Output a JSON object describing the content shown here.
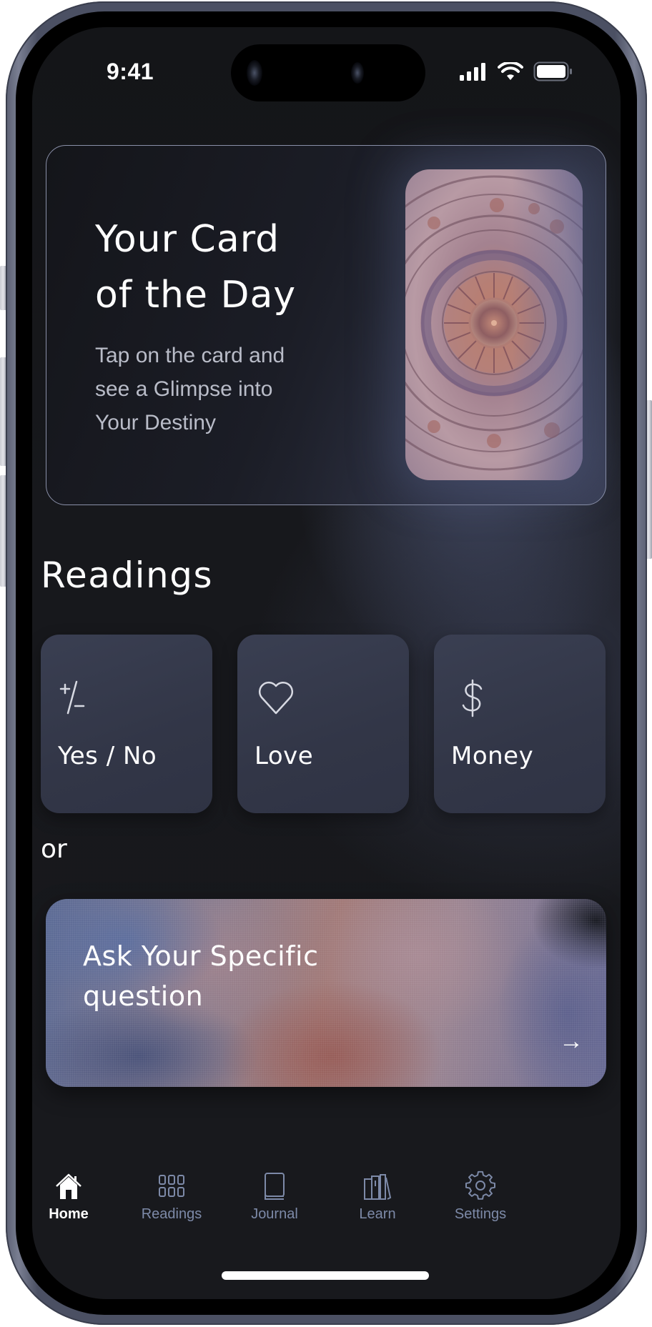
{
  "status_bar": {
    "time": "9:41",
    "icons": [
      "cellular-signal-icon",
      "wifi-icon",
      "battery-icon"
    ]
  },
  "card_of_day": {
    "title_line1": "Your Card",
    "title_line2": "of the Day",
    "subtitle_line1": "Tap on the card and",
    "subtitle_line2": "see a Glimpse into",
    "subtitle_line3": "Your Destiny",
    "image": "astrological-wheel-tarot-card"
  },
  "readings": {
    "title": "Readings",
    "tiles": [
      {
        "label": "Yes / No",
        "icon": "plus-minus-icon"
      },
      {
        "label": "Love",
        "icon": "heart-icon"
      },
      {
        "label": "Money",
        "icon": "dollar-icon"
      }
    ]
  },
  "or_label": "or",
  "ask": {
    "title_line1": "Ask Your Specific",
    "title_line2": "question",
    "arrow": "→"
  },
  "tabbar": {
    "active": "Home",
    "tabs": [
      {
        "label": "Home",
        "icon": "home-icon"
      },
      {
        "label": "Readings",
        "icon": "grid-icon"
      },
      {
        "label": "Journal",
        "icon": "book-icon"
      },
      {
        "label": "Learn",
        "icon": "books-icon"
      },
      {
        "label": "Settings",
        "icon": "gear-icon"
      }
    ]
  },
  "colors": {
    "background": "#16171b",
    "tile": "#353a4c",
    "tab_inactive": "#7d8aa8",
    "tab_active": "#ffffff",
    "hero_border": "#8a90a8"
  }
}
